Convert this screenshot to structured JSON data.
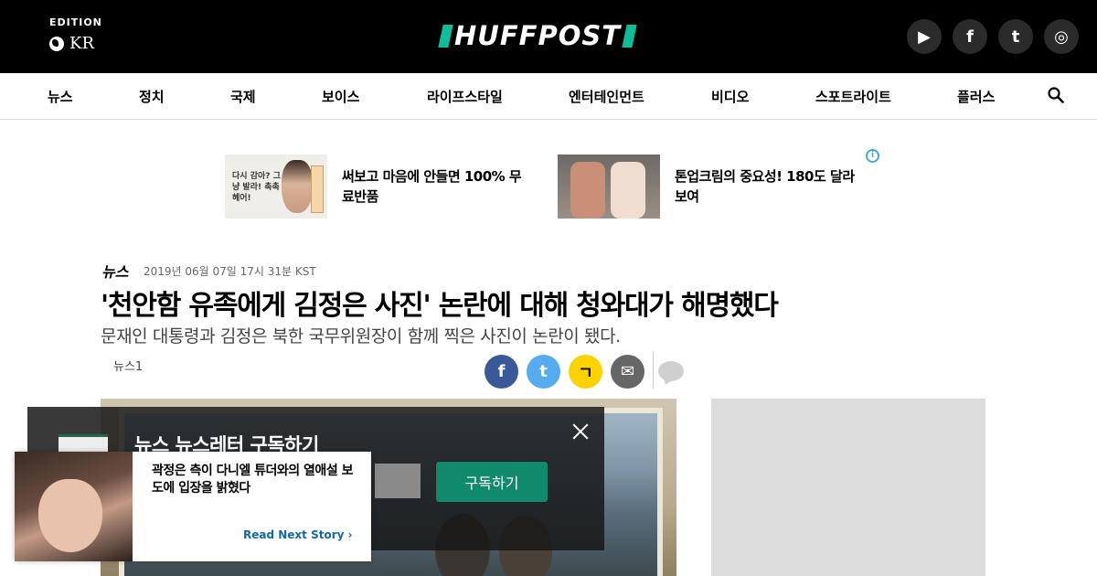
{
  "header": {
    "edition_label": "EDITION",
    "edition_code": "KR",
    "logo_text": "HUFFPOST",
    "brand_color": "#0dbe98",
    "social": [
      {
        "icon": "youtube-icon",
        "glyph": "▶"
      },
      {
        "icon": "facebook-icon",
        "glyph": "f"
      },
      {
        "icon": "twitter-icon",
        "glyph": "t"
      },
      {
        "icon": "instagram-icon",
        "glyph": "◎"
      }
    ]
  },
  "nav": {
    "items": [
      "뉴스",
      "정치",
      "국제",
      "보이스",
      "라이프스타일",
      "엔터테인먼트",
      "비디오",
      "스포트라이트",
      "플러스"
    ],
    "search_icon": "search-icon"
  },
  "ads": [
    {
      "image_text": "다시 감아? 그냥 발라! 촉촉 헤어!",
      "text": "써보고 마음에 안들면 100% 무료반품"
    },
    {
      "text": "톤업크림의 중요성! 180도 달라보여"
    }
  ],
  "article": {
    "section": "뉴스",
    "timestamp": "2019년 06월 07일 17시 31분 KST",
    "headline": "'천안함 유족에게 김정은 사진' 논란에 대해 청와대가 해명했다",
    "dek": "문재인 대통령과 김정은 북한 국무위원장이 함께 찍은 사진이 논란이 됐다.",
    "byline": "뉴스1",
    "share_buttons": [
      {
        "name": "facebook-share",
        "glyph": "f",
        "color": "#3b5998"
      },
      {
        "name": "twitter-share",
        "glyph": "t",
        "color": "#55acee"
      },
      {
        "name": "kakao-share",
        "glyph": "ㄱ",
        "color": "#fcd200"
      },
      {
        "name": "email-share",
        "glyph": "✉",
        "color": "#666666"
      }
    ]
  },
  "newsletter": {
    "title": "뉴스 뉴스레터 구독하기",
    "button": "구독하기"
  },
  "next_story": {
    "title": "곽정은 측이 다니엘 튜더와의 열애설 보도에 입장을 밝혔다",
    "link": "Read Next Story ›"
  }
}
